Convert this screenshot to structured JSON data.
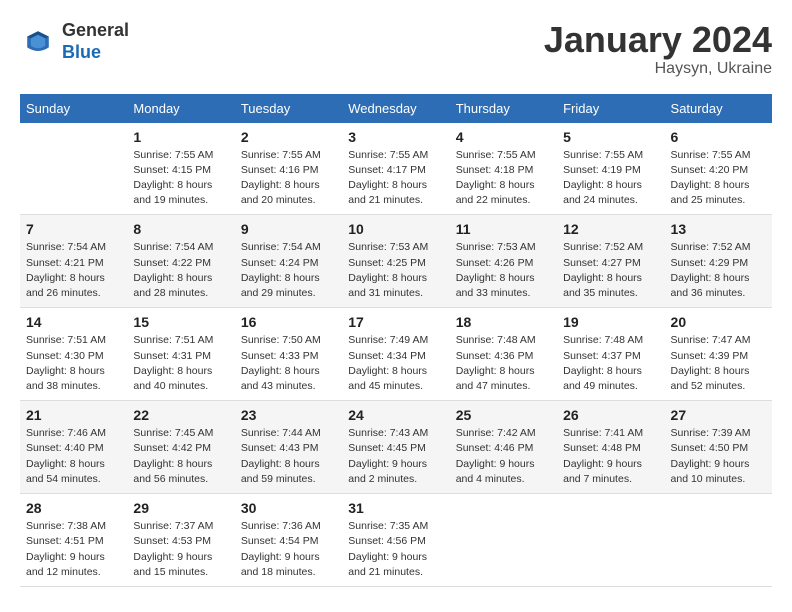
{
  "header": {
    "logo": {
      "general": "General",
      "blue": "Blue"
    },
    "title": "January 2024",
    "location": "Haysyn, Ukraine"
  },
  "weekdays": [
    "Sunday",
    "Monday",
    "Tuesday",
    "Wednesday",
    "Thursday",
    "Friday",
    "Saturday"
  ],
  "weeks": [
    [
      {
        "day": "",
        "sunrise": "",
        "sunset": "",
        "daylight": ""
      },
      {
        "day": "1",
        "sunrise": "Sunrise: 7:55 AM",
        "sunset": "Sunset: 4:15 PM",
        "daylight": "Daylight: 8 hours and 19 minutes."
      },
      {
        "day": "2",
        "sunrise": "Sunrise: 7:55 AM",
        "sunset": "Sunset: 4:16 PM",
        "daylight": "Daylight: 8 hours and 20 minutes."
      },
      {
        "day": "3",
        "sunrise": "Sunrise: 7:55 AM",
        "sunset": "Sunset: 4:17 PM",
        "daylight": "Daylight: 8 hours and 21 minutes."
      },
      {
        "day": "4",
        "sunrise": "Sunrise: 7:55 AM",
        "sunset": "Sunset: 4:18 PM",
        "daylight": "Daylight: 8 hours and 22 minutes."
      },
      {
        "day": "5",
        "sunrise": "Sunrise: 7:55 AM",
        "sunset": "Sunset: 4:19 PM",
        "daylight": "Daylight: 8 hours and 24 minutes."
      },
      {
        "day": "6",
        "sunrise": "Sunrise: 7:55 AM",
        "sunset": "Sunset: 4:20 PM",
        "daylight": "Daylight: 8 hours and 25 minutes."
      }
    ],
    [
      {
        "day": "7",
        "sunrise": "Sunrise: 7:54 AM",
        "sunset": "Sunset: 4:21 PM",
        "daylight": "Daylight: 8 hours and 26 minutes."
      },
      {
        "day": "8",
        "sunrise": "Sunrise: 7:54 AM",
        "sunset": "Sunset: 4:22 PM",
        "daylight": "Daylight: 8 hours and 28 minutes."
      },
      {
        "day": "9",
        "sunrise": "Sunrise: 7:54 AM",
        "sunset": "Sunset: 4:24 PM",
        "daylight": "Daylight: 8 hours and 29 minutes."
      },
      {
        "day": "10",
        "sunrise": "Sunrise: 7:53 AM",
        "sunset": "Sunset: 4:25 PM",
        "daylight": "Daylight: 8 hours and 31 minutes."
      },
      {
        "day": "11",
        "sunrise": "Sunrise: 7:53 AM",
        "sunset": "Sunset: 4:26 PM",
        "daylight": "Daylight: 8 hours and 33 minutes."
      },
      {
        "day": "12",
        "sunrise": "Sunrise: 7:52 AM",
        "sunset": "Sunset: 4:27 PM",
        "daylight": "Daylight: 8 hours and 35 minutes."
      },
      {
        "day": "13",
        "sunrise": "Sunrise: 7:52 AM",
        "sunset": "Sunset: 4:29 PM",
        "daylight": "Daylight: 8 hours and 36 minutes."
      }
    ],
    [
      {
        "day": "14",
        "sunrise": "Sunrise: 7:51 AM",
        "sunset": "Sunset: 4:30 PM",
        "daylight": "Daylight: 8 hours and 38 minutes."
      },
      {
        "day": "15",
        "sunrise": "Sunrise: 7:51 AM",
        "sunset": "Sunset: 4:31 PM",
        "daylight": "Daylight: 8 hours and 40 minutes."
      },
      {
        "day": "16",
        "sunrise": "Sunrise: 7:50 AM",
        "sunset": "Sunset: 4:33 PM",
        "daylight": "Daylight: 8 hours and 43 minutes."
      },
      {
        "day": "17",
        "sunrise": "Sunrise: 7:49 AM",
        "sunset": "Sunset: 4:34 PM",
        "daylight": "Daylight: 8 hours and 45 minutes."
      },
      {
        "day": "18",
        "sunrise": "Sunrise: 7:48 AM",
        "sunset": "Sunset: 4:36 PM",
        "daylight": "Daylight: 8 hours and 47 minutes."
      },
      {
        "day": "19",
        "sunrise": "Sunrise: 7:48 AM",
        "sunset": "Sunset: 4:37 PM",
        "daylight": "Daylight: 8 hours and 49 minutes."
      },
      {
        "day": "20",
        "sunrise": "Sunrise: 7:47 AM",
        "sunset": "Sunset: 4:39 PM",
        "daylight": "Daylight: 8 hours and 52 minutes."
      }
    ],
    [
      {
        "day": "21",
        "sunrise": "Sunrise: 7:46 AM",
        "sunset": "Sunset: 4:40 PM",
        "daylight": "Daylight: 8 hours and 54 minutes."
      },
      {
        "day": "22",
        "sunrise": "Sunrise: 7:45 AM",
        "sunset": "Sunset: 4:42 PM",
        "daylight": "Daylight: 8 hours and 56 minutes."
      },
      {
        "day": "23",
        "sunrise": "Sunrise: 7:44 AM",
        "sunset": "Sunset: 4:43 PM",
        "daylight": "Daylight: 8 hours and 59 minutes."
      },
      {
        "day": "24",
        "sunrise": "Sunrise: 7:43 AM",
        "sunset": "Sunset: 4:45 PM",
        "daylight": "Daylight: 9 hours and 2 minutes."
      },
      {
        "day": "25",
        "sunrise": "Sunrise: 7:42 AM",
        "sunset": "Sunset: 4:46 PM",
        "daylight": "Daylight: 9 hours and 4 minutes."
      },
      {
        "day": "26",
        "sunrise": "Sunrise: 7:41 AM",
        "sunset": "Sunset: 4:48 PM",
        "daylight": "Daylight: 9 hours and 7 minutes."
      },
      {
        "day": "27",
        "sunrise": "Sunrise: 7:39 AM",
        "sunset": "Sunset: 4:50 PM",
        "daylight": "Daylight: 9 hours and 10 minutes."
      }
    ],
    [
      {
        "day": "28",
        "sunrise": "Sunrise: 7:38 AM",
        "sunset": "Sunset: 4:51 PM",
        "daylight": "Daylight: 9 hours and 12 minutes."
      },
      {
        "day": "29",
        "sunrise": "Sunrise: 7:37 AM",
        "sunset": "Sunset: 4:53 PM",
        "daylight": "Daylight: 9 hours and 15 minutes."
      },
      {
        "day": "30",
        "sunrise": "Sunrise: 7:36 AM",
        "sunset": "Sunset: 4:54 PM",
        "daylight": "Daylight: 9 hours and 18 minutes."
      },
      {
        "day": "31",
        "sunrise": "Sunrise: 7:35 AM",
        "sunset": "Sunset: 4:56 PM",
        "daylight": "Daylight: 9 hours and 21 minutes."
      },
      {
        "day": "",
        "sunrise": "",
        "sunset": "",
        "daylight": ""
      },
      {
        "day": "",
        "sunrise": "",
        "sunset": "",
        "daylight": ""
      },
      {
        "day": "",
        "sunrise": "",
        "sunset": "",
        "daylight": ""
      }
    ]
  ]
}
